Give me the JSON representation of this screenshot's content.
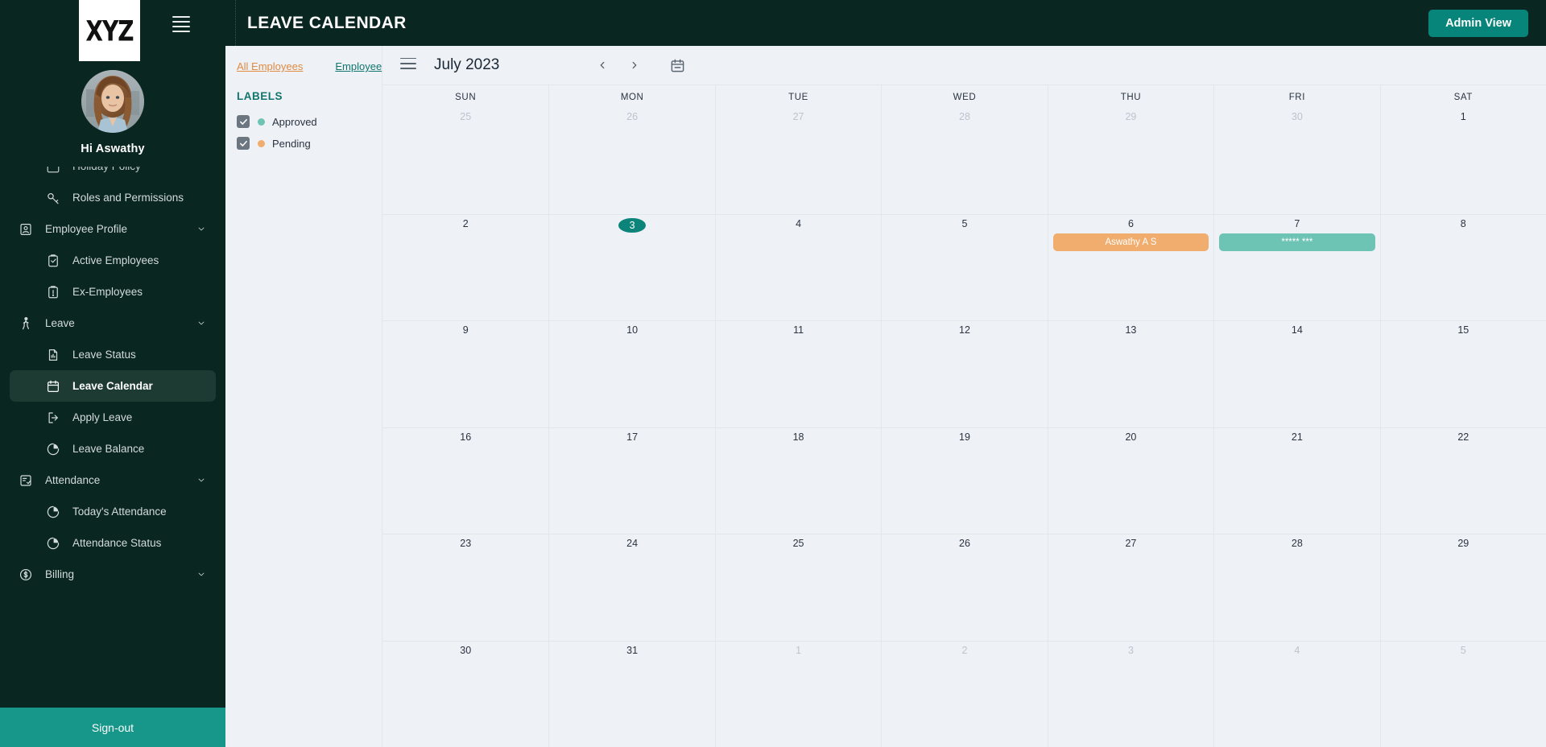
{
  "brand": {
    "logo_text": "XYZ"
  },
  "sidebar": {
    "greeting": "Hi Aswathy",
    "hamburger_icon": "hamburger-icon",
    "items": [
      {
        "label": "Holiday Policy",
        "icon": "calendar-star-icon",
        "level": "child",
        "active": false,
        "partial": true
      },
      {
        "label": "Roles and Permissions",
        "icon": "key-icon",
        "level": "child",
        "active": false
      },
      {
        "label": "Employee Profile",
        "icon": "id-card-icon",
        "level": "parent",
        "active": false,
        "expandable": true
      },
      {
        "label": "Active Employees",
        "icon": "clipboard-check-icon",
        "level": "child",
        "active": false
      },
      {
        "label": "Ex-Employees",
        "icon": "clipboard-alert-icon",
        "level": "child",
        "active": false
      },
      {
        "label": "Leave",
        "icon": "walking-person-icon",
        "level": "parent",
        "active": false,
        "expandable": true
      },
      {
        "label": "Leave Status",
        "icon": "document-chart-icon",
        "level": "child",
        "active": false
      },
      {
        "label": "Leave Calendar",
        "icon": "calendar-icon",
        "level": "child",
        "active": true
      },
      {
        "label": "Apply Leave",
        "icon": "logout-arrow-icon",
        "level": "child",
        "active": false
      },
      {
        "label": "Leave Balance",
        "icon": "pie-chart-icon",
        "level": "child",
        "active": false
      },
      {
        "label": "Attendance",
        "icon": "list-check-icon",
        "level": "parent",
        "active": false,
        "expandable": true
      },
      {
        "label": "Today's Attendance",
        "icon": "pie-chart-icon",
        "level": "child",
        "active": false
      },
      {
        "label": "Attendance Status",
        "icon": "pie-chart-icon",
        "level": "child",
        "active": false
      },
      {
        "label": "Billing",
        "icon": "dollar-circle-icon",
        "level": "parent",
        "active": false,
        "expandable": true
      }
    ],
    "signout_label": "Sign-out"
  },
  "header": {
    "title": "LEAVE CALENDAR",
    "admin_button_label": "Admin View"
  },
  "filters": {
    "all_employees_label": "All Employees",
    "employee_label": "Employee",
    "labels_heading": "LABELS",
    "legend": [
      {
        "label": "Approved",
        "color": "#6ec4b4",
        "checked": true
      },
      {
        "label": "Pending",
        "color": "#f0ad6e",
        "checked": true
      }
    ]
  },
  "calendar": {
    "menu_icon": "hamburger-icon",
    "month_label": "July 2023",
    "prev_icon": "chevron-left-icon",
    "next_icon": "chevron-right-icon",
    "date_picker_icon": "calendar-icon",
    "day_headers": [
      "SUN",
      "MON",
      "TUE",
      "WED",
      "THU",
      "FRI",
      "SAT"
    ],
    "weeks": [
      [
        {
          "day": "25",
          "other": true,
          "today": false,
          "events": []
        },
        {
          "day": "26",
          "other": true,
          "today": false,
          "events": []
        },
        {
          "day": "27",
          "other": true,
          "today": false,
          "events": []
        },
        {
          "day": "28",
          "other": true,
          "today": false,
          "events": []
        },
        {
          "day": "29",
          "other": true,
          "today": false,
          "events": []
        },
        {
          "day": "30",
          "other": true,
          "today": false,
          "events": []
        },
        {
          "day": "1",
          "other": false,
          "today": false,
          "events": []
        }
      ],
      [
        {
          "day": "2",
          "other": false,
          "today": false,
          "events": []
        },
        {
          "day": "3",
          "other": false,
          "today": true,
          "events": []
        },
        {
          "day": "4",
          "other": false,
          "today": false,
          "events": []
        },
        {
          "day": "5",
          "other": false,
          "today": false,
          "events": []
        },
        {
          "day": "6",
          "other": false,
          "today": false,
          "events": [
            {
              "title": "Aswathy A S",
              "status": "Pending",
              "color": "#f0ad6e"
            }
          ]
        },
        {
          "day": "7",
          "other": false,
          "today": false,
          "events": [
            {
              "title": "***** ***",
              "status": "Approved",
              "color": "#6ec4b4"
            }
          ]
        },
        {
          "day": "8",
          "other": false,
          "today": false,
          "events": []
        }
      ],
      [
        {
          "day": "9",
          "other": false,
          "today": false,
          "events": []
        },
        {
          "day": "10",
          "other": false,
          "today": false,
          "events": []
        },
        {
          "day": "11",
          "other": false,
          "today": false,
          "events": []
        },
        {
          "day": "12",
          "other": false,
          "today": false,
          "events": []
        },
        {
          "day": "13",
          "other": false,
          "today": false,
          "events": []
        },
        {
          "day": "14",
          "other": false,
          "today": false,
          "events": []
        },
        {
          "day": "15",
          "other": false,
          "today": false,
          "events": []
        }
      ],
      [
        {
          "day": "16",
          "other": false,
          "today": false,
          "events": []
        },
        {
          "day": "17",
          "other": false,
          "today": false,
          "events": []
        },
        {
          "day": "18",
          "other": false,
          "today": false,
          "events": []
        },
        {
          "day": "19",
          "other": false,
          "today": false,
          "events": []
        },
        {
          "day": "20",
          "other": false,
          "today": false,
          "events": []
        },
        {
          "day": "21",
          "other": false,
          "today": false,
          "events": []
        },
        {
          "day": "22",
          "other": false,
          "today": false,
          "events": []
        }
      ],
      [
        {
          "day": "23",
          "other": false,
          "today": false,
          "events": []
        },
        {
          "day": "24",
          "other": false,
          "today": false,
          "events": []
        },
        {
          "day": "25",
          "other": false,
          "today": false,
          "events": []
        },
        {
          "day": "26",
          "other": false,
          "today": false,
          "events": []
        },
        {
          "day": "27",
          "other": false,
          "today": false,
          "events": []
        },
        {
          "day": "28",
          "other": false,
          "today": false,
          "events": []
        },
        {
          "day": "29",
          "other": false,
          "today": false,
          "events": []
        }
      ],
      [
        {
          "day": "30",
          "other": false,
          "today": false,
          "events": []
        },
        {
          "day": "31",
          "other": false,
          "today": false,
          "events": []
        },
        {
          "day": "1",
          "other": true,
          "today": false,
          "events": []
        },
        {
          "day": "2",
          "other": true,
          "today": false,
          "events": []
        },
        {
          "day": "3",
          "other": true,
          "today": false,
          "events": []
        },
        {
          "day": "4",
          "other": true,
          "today": false,
          "events": []
        },
        {
          "day": "5",
          "other": true,
          "today": false,
          "events": []
        }
      ]
    ]
  },
  "colors": {
    "sidebar_bg": "#0a2620",
    "accent_teal": "#08857a",
    "signout_bg": "#17968a",
    "approved": "#6ec4b4",
    "pending": "#f0ad6e",
    "link_orange": "#e08b42",
    "link_teal": "#11756e"
  }
}
